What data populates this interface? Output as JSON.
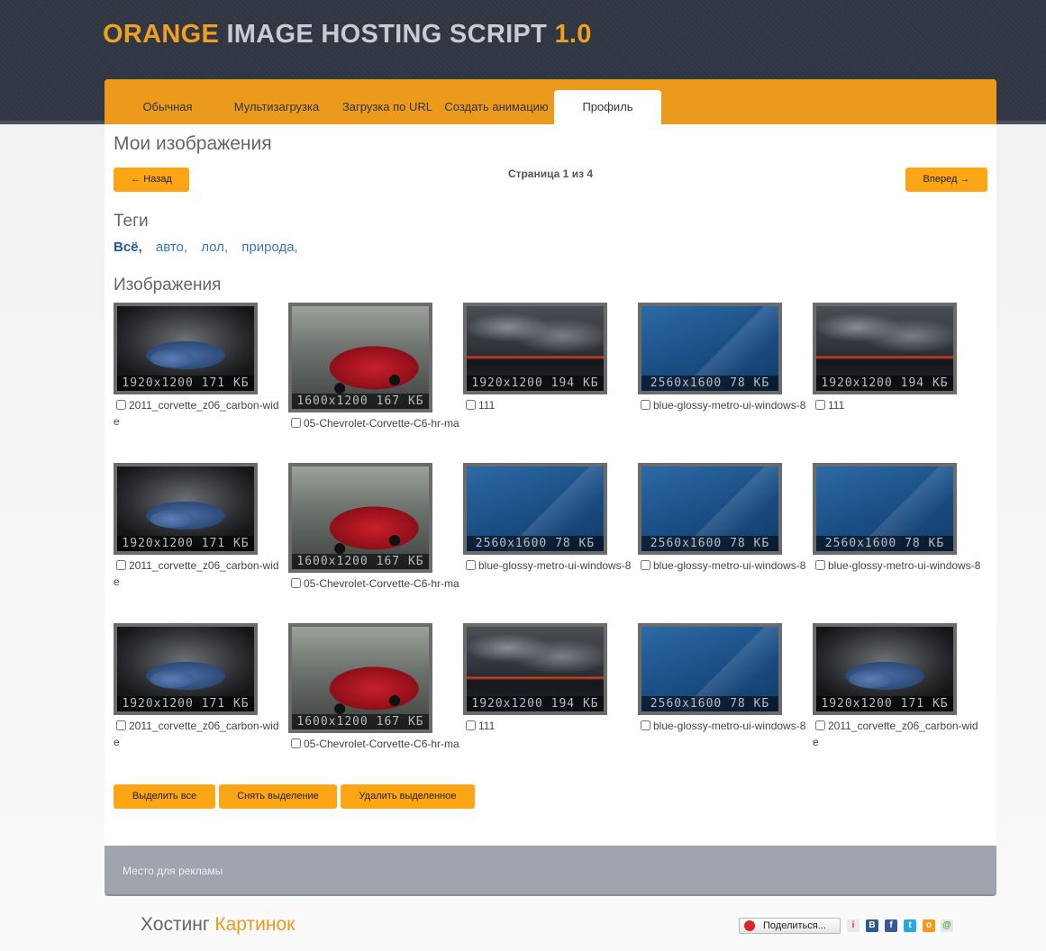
{
  "header": {
    "title_prefix": "ORANGE",
    "title_main": " IMAGE HOSTING SCRIPT ",
    "title_version": "1.0"
  },
  "tabs": [
    {
      "label": "Обычная"
    },
    {
      "label": "Мультизагрузка"
    },
    {
      "label": "Загрузка по URL"
    },
    {
      "label": "Создать анимацию"
    },
    {
      "label": "Профиль",
      "active": true
    }
  ],
  "page": {
    "title": "Мои изображения",
    "prev_label": "← Назад",
    "next_label": "Вперед →",
    "page_word": "Страница",
    "page_current": "1",
    "page_of": "из",
    "page_total": "4"
  },
  "tags": {
    "title": "Теги",
    "items": [
      "Всё,",
      "авто,",
      "лол,",
      "природа,"
    ]
  },
  "images": {
    "title": "Изображения",
    "items": [
      {
        "info": "1920x1200 171 КБ",
        "name": "2011_corvette_z06_carbon-wide",
        "kind": "car-blue"
      },
      {
        "info": "1600x1200 167 КБ",
        "name": "05-Chevrolet-Corvette-C6-hr-ma",
        "kind": "car-red"
      },
      {
        "info": "1920x1200 194 КБ",
        "name": "111",
        "kind": "sky"
      },
      {
        "info": "2560x1600 78 КБ",
        "name": "blue-glossy-metro-ui-windows-8",
        "kind": "metro"
      },
      {
        "info": "1920x1200 194 КБ",
        "name": "111",
        "kind": "sky"
      },
      {
        "info": "1920x1200 171 КБ",
        "name": "2011_corvette_z06_carbon-wide",
        "kind": "car-blue"
      },
      {
        "info": "1600x1200 167 КБ",
        "name": "05-Chevrolet-Corvette-C6-hr-ma",
        "kind": "car-red"
      },
      {
        "info": "2560x1600 78 КБ",
        "name": "blue-glossy-metro-ui-windows-8",
        "kind": "metro"
      },
      {
        "info": "2560x1600 78 КБ",
        "name": "blue-glossy-metro-ui-windows-8",
        "kind": "metro"
      },
      {
        "info": "2560x1600 78 КБ",
        "name": "blue-glossy-metro-ui-windows-8",
        "kind": "metro"
      },
      {
        "info": "1920x1200 171 КБ",
        "name": "2011_corvette_z06_carbon-wide",
        "kind": "car-blue"
      },
      {
        "info": "1600x1200 167 КБ",
        "name": "05-Chevrolet-Corvette-C6-hr-ma",
        "kind": "car-red"
      },
      {
        "info": "1920x1200 194 КБ",
        "name": "111",
        "kind": "sky"
      },
      {
        "info": "2560x1600 78 КБ",
        "name": "blue-glossy-metro-ui-windows-8",
        "kind": "metro"
      },
      {
        "info": "1920x1200 171 КБ",
        "name": "2011_corvette_z06_carbon-wide",
        "kind": "car-blue"
      }
    ]
  },
  "actions": {
    "select_all": "Выделить все",
    "deselect": "Снять выделение",
    "delete_selected": "Удалить выделенное"
  },
  "ad": {
    "text": "Место для рекламы"
  },
  "footer": {
    "brand_a": "Хостинг ",
    "brand_b": "Картинок",
    "share_label": "Поделиться..."
  },
  "colors": {
    "accent": "#ec9a1c",
    "button": "#fca515",
    "header_bg": "#2f3541"
  }
}
